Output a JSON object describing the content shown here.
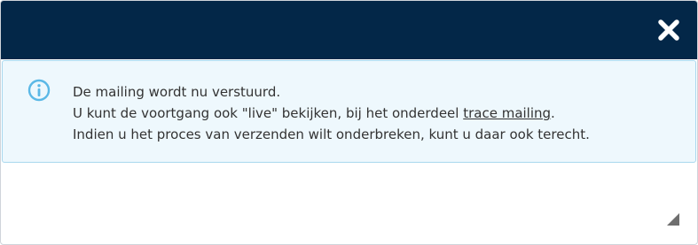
{
  "dialog": {
    "close_icon": "close-icon"
  },
  "info": {
    "icon": "info-icon",
    "line1": "De mailing wordt nu verstuurd.",
    "line2_prefix": "U kunt de voortgang ook \"live\" bekijken, bij het onderdeel ",
    "line2_link": "trace mailing",
    "line2_suffix": ".",
    "line3": "Indien u het proces van verzenden wilt onderbreken, kunt u daar ook terecht."
  },
  "colors": {
    "titlebar": "#032748",
    "info_background": "#eef8fd",
    "info_border": "#a9d8ee",
    "info_icon": "#5bb8e6"
  }
}
